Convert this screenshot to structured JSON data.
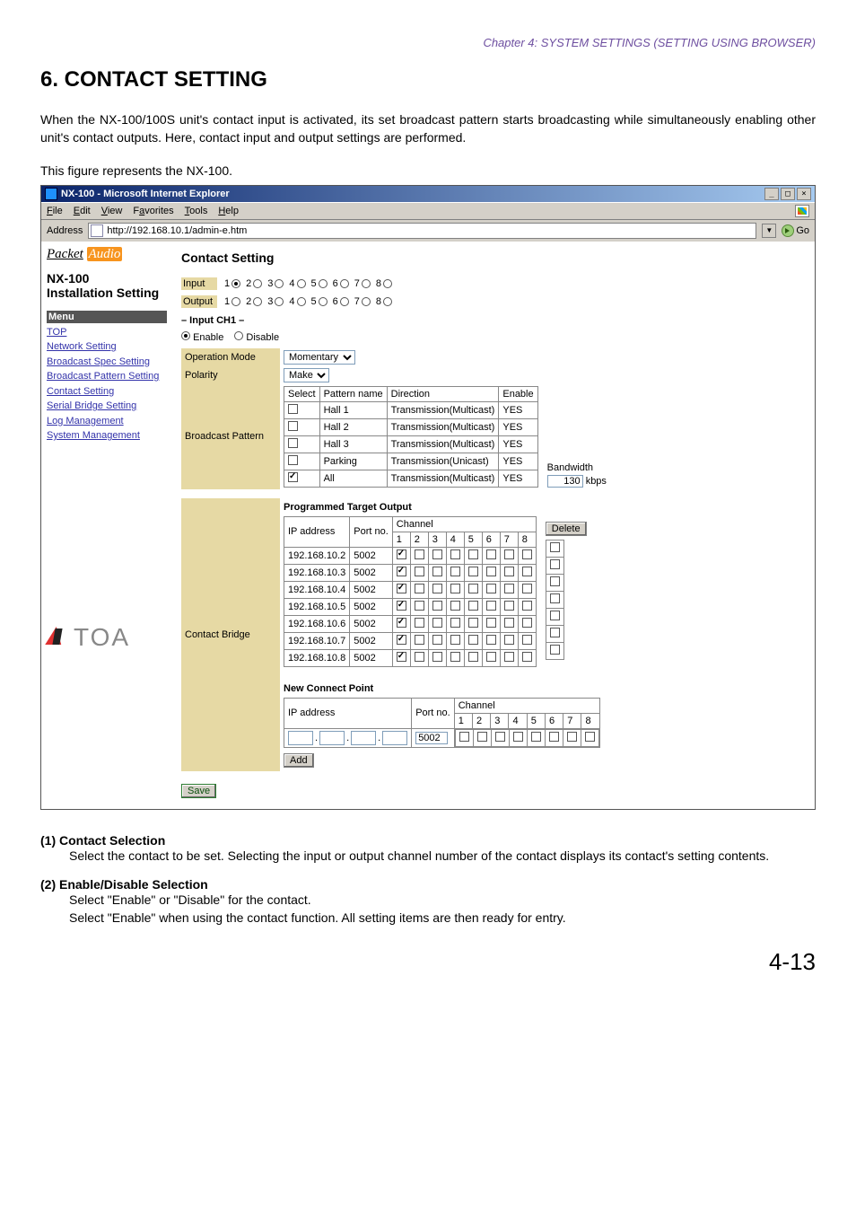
{
  "chapter_header": "Chapter 4:  SYSTEM SETTINGS (SETTING USING BROWSER)",
  "section_title": "6. CONTACT SETTING",
  "intro": "When the NX-100/100S unit's contact input is activated, its set broadcast pattern starts broadcasting while simultaneously enabling other unit's contact outputs. Here, contact input and output settings are performed.",
  "caption": "This figure represents the NX-100.",
  "browser": {
    "title": "NX-100 - Microsoft Internet Explorer",
    "menus": {
      "file": "File",
      "edit": "Edit",
      "view": "View",
      "favorites": "Favorites",
      "tools": "Tools",
      "help": "Help"
    },
    "address_label": "Address",
    "url": "http://192.168.10.1/admin-e.htm",
    "go": "Go"
  },
  "sidebar": {
    "packet_audio_1": "Packet",
    "packet_audio_2": "Audio",
    "nx100": "NX-100",
    "install": "Installation Setting",
    "menu_hdr": "Menu",
    "links": {
      "top": "TOP",
      "network": "Network Setting",
      "bspec": "Broadcast Spec Setting",
      "bpattern": "Broadcast Pattern Setting",
      "contact": "Contact Setting",
      "serial": "Serial Bridge Setting",
      "log": "Log Management",
      "sysmgmt": "System Management"
    },
    "toa": "TOA"
  },
  "main": {
    "heading": "Contact Setting",
    "input_lbl": "Input",
    "output_lbl": "Output",
    "nums": [
      "1",
      "2",
      "3",
      "4",
      "5",
      "6",
      "7",
      "8"
    ],
    "input_selected": 1,
    "channel_head": "– Input CH1 –",
    "enable": "Enable",
    "disable": "Disable",
    "enable_selected": true,
    "op_mode_lbl": "Operation Mode",
    "op_mode_val": "Momentary",
    "polarity_lbl": "Polarity",
    "polarity_val": "Make",
    "bp_lbl": "Broadcast Pattern",
    "bp_cols": {
      "select": "Select",
      "name": "Pattern name",
      "dir": "Direction",
      "en": "Enable"
    },
    "bp_rows": [
      {
        "sel": false,
        "name": "Hall 1",
        "dir": "Transmission(Multicast)",
        "en": "YES"
      },
      {
        "sel": false,
        "name": "Hall 2",
        "dir": "Transmission(Multicast)",
        "en": "YES"
      },
      {
        "sel": false,
        "name": "Hall 3",
        "dir": "Transmission(Multicast)",
        "en": "YES"
      },
      {
        "sel": false,
        "name": "Parking",
        "dir": "Transmission(Unicast)",
        "en": "YES"
      },
      {
        "sel": true,
        "name": "All",
        "dir": "Transmission(Multicast)",
        "en": "YES"
      }
    ],
    "bandwidth_lbl": "Bandwidth",
    "bandwidth_val": "130",
    "bandwidth_unit": "kbps",
    "cb_lbl": "Contact Bridge",
    "pto_head": "Programmed Target Output",
    "pto_cols": {
      "ip": "IP address",
      "port": "Port no.",
      "ch": "Channel",
      "del": "Delete"
    },
    "ch_nums": [
      "1",
      "2",
      "3",
      "4",
      "5",
      "6",
      "7",
      "8"
    ],
    "pto_rows": [
      {
        "ip": "192.168.10.2",
        "port": "5002",
        "ch": [
          true,
          false,
          false,
          false,
          false,
          false,
          false,
          false
        ],
        "del": false
      },
      {
        "ip": "192.168.10.3",
        "port": "5002",
        "ch": [
          true,
          false,
          false,
          false,
          false,
          false,
          false,
          false
        ],
        "del": false
      },
      {
        "ip": "192.168.10.4",
        "port": "5002",
        "ch": [
          true,
          false,
          false,
          false,
          false,
          false,
          false,
          false
        ],
        "del": false
      },
      {
        "ip": "192.168.10.5",
        "port": "5002",
        "ch": [
          true,
          false,
          false,
          false,
          false,
          false,
          false,
          false
        ],
        "del": false
      },
      {
        "ip": "192.168.10.6",
        "port": "5002",
        "ch": [
          true,
          false,
          false,
          false,
          false,
          false,
          false,
          false
        ],
        "del": false
      },
      {
        "ip": "192.168.10.7",
        "port": "5002",
        "ch": [
          true,
          false,
          false,
          false,
          false,
          false,
          false,
          false
        ],
        "del": false
      },
      {
        "ip": "192.168.10.8",
        "port": "5002",
        "ch": [
          true,
          false,
          false,
          false,
          false,
          false,
          false,
          false
        ],
        "del": false
      }
    ],
    "ncp_head": "New Connect Point",
    "ncp_ip_lbl": "IP address",
    "ncp_port_lbl": "Port no.",
    "ncp_ch_lbl": "Channel",
    "ncp_port_val": "5002",
    "add_btn": "Add",
    "save_btn": "Save"
  },
  "notes": {
    "n1_title": "(1)  Contact Selection",
    "n1_body": "Select the contact to be set. Selecting the input or output channel number of the contact displays its contact's setting contents.",
    "n2_title": "(2)  Enable/Disable Selection",
    "n2_body_a": "Select \"Enable\" or \"Disable\" for the contact.",
    "n2_body_b": "Select \"Enable\" when using the contact function. All setting items are then ready for entry."
  },
  "page_num": "4-13"
}
